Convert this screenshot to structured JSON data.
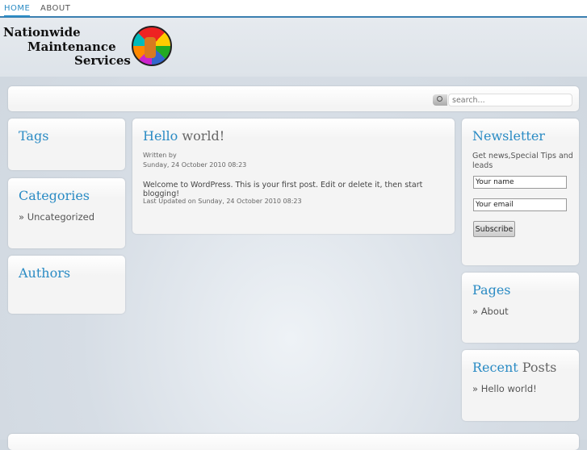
{
  "nav": {
    "items": [
      {
        "label": "HOME"
      },
      {
        "label": "ABOUT"
      }
    ]
  },
  "logo": {
    "line1": "Nationwide",
    "line2": "Maintenance",
    "line3": "Services"
  },
  "search": {
    "placeholder": "search..."
  },
  "left": {
    "tags": {
      "title": "Tags"
    },
    "categories": {
      "title": "Categories",
      "items": [
        "» Uncategorized"
      ]
    },
    "authors": {
      "title": "Authors"
    }
  },
  "post": {
    "title_first": "Hello",
    "title_rest": "world!",
    "written_by": "Written by",
    "date": "Sunday, 24 October 2010 08:23",
    "body": "Welcome to WordPress. This is your first post. Edit or delete it, then start blogging!",
    "updated": "Last Updated on Sunday, 24 October 2010 08:23"
  },
  "newsletter": {
    "title": "Newsletter",
    "desc": "Get news,Special Tips and leads",
    "name_value": "Your name",
    "email_value": "Your email",
    "subscribe": "Subscribe"
  },
  "pages": {
    "title": "Pages",
    "items": [
      "» About"
    ]
  },
  "recent": {
    "title_first": "Recent",
    "title_rest": "Posts",
    "items": [
      "» Hello world!"
    ]
  }
}
